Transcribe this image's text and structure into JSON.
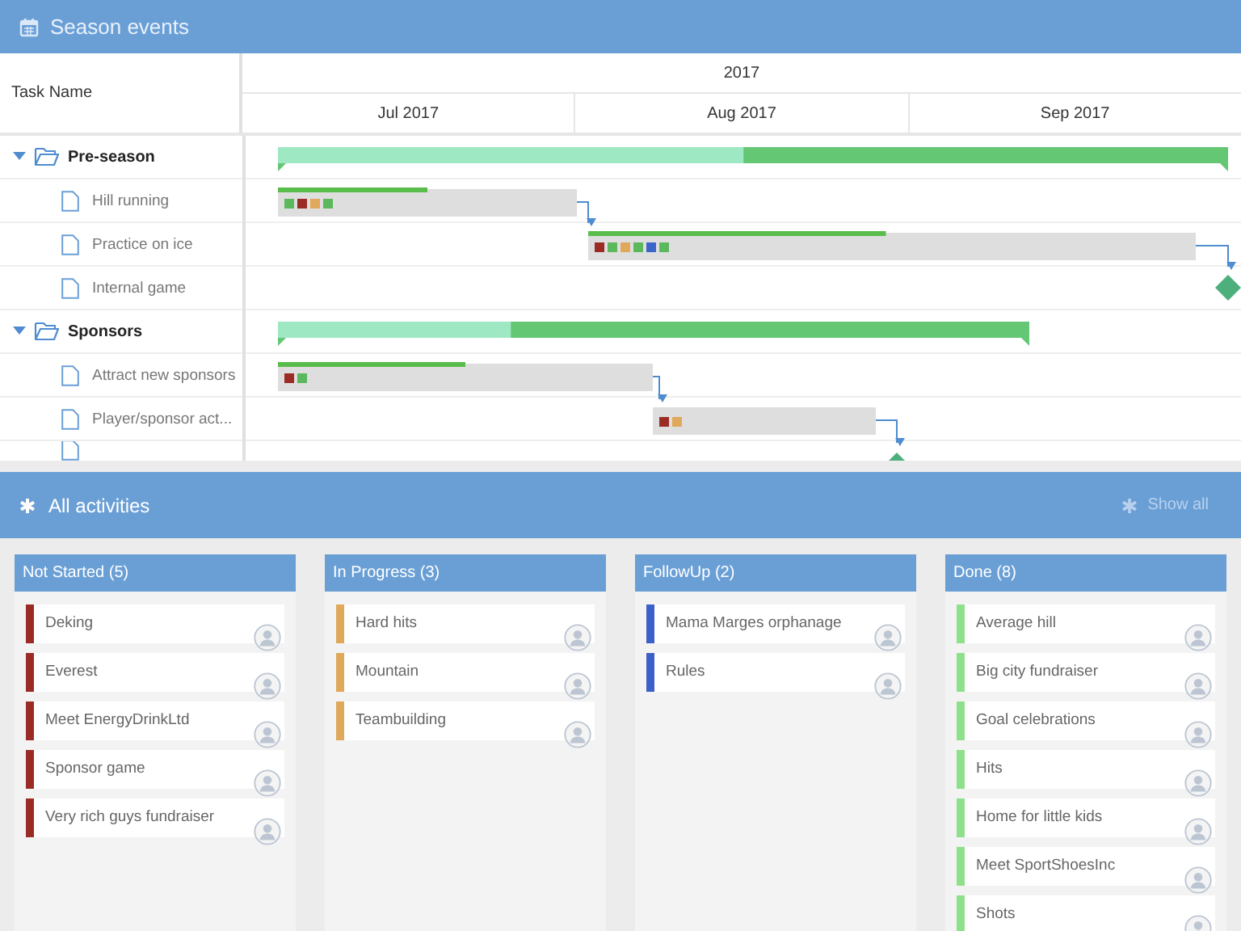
{
  "header": {
    "title": "Season events"
  },
  "gantt": {
    "column_title": "Task Name",
    "year": "2017",
    "months": [
      "Jul 2017",
      "Aug 2017",
      "Sep 2017"
    ],
    "tasks": [
      {
        "name": "Pre-season",
        "kind": "group",
        "expanded": true,
        "level": 0.49,
        "children": [
          {
            "name": "Hill running",
            "kind": "task",
            "level": 0.5,
            "tags": [
              {
                "color": "#5cb85c"
              },
              {
                "color": "#9b2b25"
              },
              {
                "color": "#e0a85a"
              },
              {
                "color": "#5cb85c"
              }
            ]
          },
          {
            "name": "Practice on ice",
            "kind": "task",
            "level": 0.49,
            "tags": [
              {
                "color": "#9b2b25"
              },
              {
                "color": "#5cb85c"
              },
              {
                "color": "#e0a85a"
              },
              {
                "color": "#5cb85c"
              },
              {
                "color": "#3d64c8"
              },
              {
                "color": "#5cb85c"
              }
            ]
          },
          {
            "name": "Internal game",
            "kind": "milestone"
          }
        ]
      },
      {
        "name": "Sponsors",
        "kind": "group",
        "expanded": true,
        "level": 0.31,
        "children": [
          {
            "name": "Attract new sponsors",
            "kind": "task",
            "level": 0.5,
            "tags": [
              {
                "color": "#9b2b25"
              },
              {
                "color": "#5cb85c"
              }
            ]
          },
          {
            "name": "Player/sponsor act...",
            "kind": "task",
            "tags": [
              {
                "color": "#9b2b25"
              },
              {
                "color": "#e0a85a"
              }
            ]
          }
        ]
      }
    ]
  },
  "board": {
    "title": "All activities",
    "show_all": "Show all",
    "columns": [
      {
        "title": "Not Started (5)",
        "color": "#9b2b25",
        "cards": [
          "Deking",
          "Everest",
          "Meet EnergyDrinkLtd",
          "Sponsor game",
          "Very rich guys fundraiser"
        ]
      },
      {
        "title": "In Progress (3)",
        "color": "#e0a85a",
        "cards": [
          "Hard hits",
          "Mountain",
          "Teambuilding"
        ]
      },
      {
        "title": "FollowUp (2)",
        "color": "#3d5fc8",
        "cards": [
          "Mama Marges orphanage",
          "Rules"
        ]
      },
      {
        "title": "Done (8)",
        "color": "#8fe08a",
        "cards": [
          "Average hill",
          "Big city fundraiser",
          "Goal celebrations",
          "Hits",
          "Home for little kids",
          "Meet SportShoesInc",
          "Shots"
        ]
      }
    ]
  }
}
